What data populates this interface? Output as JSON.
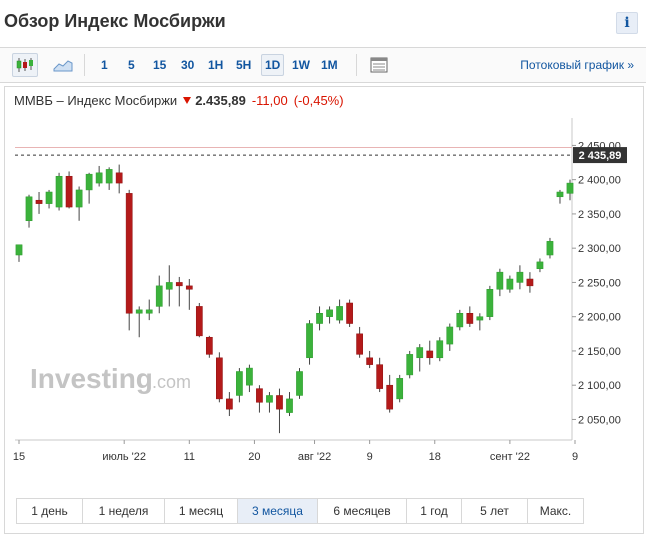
{
  "page": {
    "title": "Обзор Индекс Мосбиржи",
    "info_label": "i"
  },
  "toolbar": {
    "chart_type_icons": [
      "candlestick-icon",
      "area-chart-icon"
    ],
    "timeframes": [
      {
        "label": "1",
        "active": false
      },
      {
        "label": "5",
        "active": false
      },
      {
        "label": "15",
        "active": false
      },
      {
        "label": "30",
        "active": false
      },
      {
        "label": "1H",
        "active": false
      },
      {
        "label": "5H",
        "active": false
      },
      {
        "label": "1D",
        "active": true
      },
      {
        "label": "1W",
        "active": false
      },
      {
        "label": "1M",
        "active": false
      }
    ],
    "table_icon": "table-view-icon",
    "stream_link": "Потоковый график »"
  },
  "quote": {
    "name": "ММВБ – Индекс Мосбиржи",
    "direction": "down",
    "price": "2.435,89",
    "change": "-11,00",
    "change_pct": "(-0,45%)",
    "current_price_label": "2.435,89",
    "current_price_tag": "2 435,89"
  },
  "watermark": {
    "text": "Investing",
    "suffix": ".com"
  },
  "colors": {
    "up": "#3bb23b",
    "down": "#b41a1a",
    "link": "#1256a0",
    "negative": "#d91400"
  },
  "chart_data": {
    "type": "candlestick",
    "y_range": [
      2020,
      2490
    ],
    "y_ticks": [
      "2 050,00",
      "2 100,00",
      "2 150,00",
      "2 200,00",
      "2 250,00",
      "2 300,00",
      "2 350,00",
      "2 400,00",
      "2 450,00"
    ],
    "y_tick_values": [
      2050,
      2100,
      2150,
      2200,
      2250,
      2300,
      2350,
      2400,
      2450
    ],
    "x_ticks": [
      {
        "label": "15",
        "index": 0
      },
      {
        "label": "июль '22",
        "index": 10.5
      },
      {
        "label": "11",
        "index": 17
      },
      {
        "label": "20",
        "index": 23.5
      },
      {
        "label": "авг '22",
        "index": 29.5
      },
      {
        "label": "9",
        "index": 35
      },
      {
        "label": "18",
        "index": 41.5
      },
      {
        "label": "сент '22",
        "index": 49
      },
      {
        "label": "9",
        "index": 55.5
      }
    ],
    "reference_level": 2447,
    "current_price": 2435.89,
    "candles": [
      {
        "o": 2290,
        "h": 2295,
        "l": 2280,
        "c": 2305
      },
      {
        "o": 2340,
        "h": 2378,
        "l": 2330,
        "c": 2375
      },
      {
        "o": 2370,
        "h": 2382,
        "l": 2350,
        "c": 2365
      },
      {
        "o": 2365,
        "h": 2385,
        "l": 2358,
        "c": 2382
      },
      {
        "o": 2360,
        "h": 2410,
        "l": 2355,
        "c": 2405
      },
      {
        "o": 2405,
        "h": 2412,
        "l": 2358,
        "c": 2360
      },
      {
        "o": 2360,
        "h": 2390,
        "l": 2340,
        "c": 2385
      },
      {
        "o": 2385,
        "h": 2410,
        "l": 2365,
        "c": 2408
      },
      {
        "o": 2395,
        "h": 2420,
        "l": 2390,
        "c": 2410
      },
      {
        "o": 2395,
        "h": 2418,
        "l": 2385,
        "c": 2415
      },
      {
        "o": 2410,
        "h": 2422,
        "l": 2380,
        "c": 2395
      },
      {
        "o": 2380,
        "h": 2385,
        "l": 2180,
        "c": 2205
      },
      {
        "o": 2205,
        "h": 2215,
        "l": 2170,
        "c": 2210
      },
      {
        "o": 2205,
        "h": 2225,
        "l": 2195,
        "c": 2210
      },
      {
        "o": 2215,
        "h": 2260,
        "l": 2205,
        "c": 2245
      },
      {
        "o": 2240,
        "h": 2275,
        "l": 2215,
        "c": 2250
      },
      {
        "o": 2250,
        "h": 2258,
        "l": 2215,
        "c": 2245
      },
      {
        "o": 2245,
        "h": 2255,
        "l": 2210,
        "c": 2240
      },
      {
        "o": 2215,
        "h": 2220,
        "l": 2170,
        "c": 2172
      },
      {
        "o": 2170,
        "h": 2172,
        "l": 2140,
        "c": 2145
      },
      {
        "o": 2140,
        "h": 2148,
        "l": 2075,
        "c": 2080
      },
      {
        "o": 2080,
        "h": 2090,
        "l": 2055,
        "c": 2065
      },
      {
        "o": 2085,
        "h": 2125,
        "l": 2075,
        "c": 2120
      },
      {
        "o": 2100,
        "h": 2130,
        "l": 2090,
        "c": 2125
      },
      {
        "o": 2095,
        "h": 2100,
        "l": 2060,
        "c": 2075
      },
      {
        "o": 2075,
        "h": 2090,
        "l": 2060,
        "c": 2085
      },
      {
        "o": 2085,
        "h": 2095,
        "l": 2030,
        "c": 2065
      },
      {
        "o": 2060,
        "h": 2090,
        "l": 2055,
        "c": 2080
      },
      {
        "o": 2085,
        "h": 2125,
        "l": 2080,
        "c": 2120
      },
      {
        "o": 2140,
        "h": 2195,
        "l": 2130,
        "c": 2190
      },
      {
        "o": 2190,
        "h": 2215,
        "l": 2180,
        "c": 2205
      },
      {
        "o": 2200,
        "h": 2215,
        "l": 2190,
        "c": 2210
      },
      {
        "o": 2195,
        "h": 2225,
        "l": 2190,
        "c": 2215
      },
      {
        "o": 2220,
        "h": 2225,
        "l": 2185,
        "c": 2190
      },
      {
        "o": 2175,
        "h": 2185,
        "l": 2140,
        "c": 2145
      },
      {
        "o": 2140,
        "h": 2150,
        "l": 2125,
        "c": 2130
      },
      {
        "o": 2130,
        "h": 2140,
        "l": 2090,
        "c": 2095
      },
      {
        "o": 2100,
        "h": 2115,
        "l": 2060,
        "c": 2065
      },
      {
        "o": 2080,
        "h": 2115,
        "l": 2075,
        "c": 2110
      },
      {
        "o": 2115,
        "h": 2150,
        "l": 2110,
        "c": 2145
      },
      {
        "o": 2140,
        "h": 2160,
        "l": 2120,
        "c": 2155
      },
      {
        "o": 2150,
        "h": 2165,
        "l": 2130,
        "c": 2140
      },
      {
        "o": 2140,
        "h": 2170,
        "l": 2135,
        "c": 2165
      },
      {
        "o": 2160,
        "h": 2190,
        "l": 2150,
        "c": 2185
      },
      {
        "o": 2185,
        "h": 2210,
        "l": 2180,
        "c": 2205
      },
      {
        "o": 2205,
        "h": 2215,
        "l": 2185,
        "c": 2190
      },
      {
        "o": 2195,
        "h": 2205,
        "l": 2180,
        "c": 2200
      },
      {
        "o": 2200,
        "h": 2245,
        "l": 2195,
        "c": 2240
      },
      {
        "o": 2240,
        "h": 2270,
        "l": 2230,
        "c": 2265
      },
      {
        "o": 2240,
        "h": 2260,
        "l": 2235,
        "c": 2255
      },
      {
        "o": 2250,
        "h": 2275,
        "l": 2240,
        "c": 2265
      },
      {
        "o": 2255,
        "h": 2265,
        "l": 2235,
        "c": 2245
      },
      {
        "o": 2270,
        "h": 2285,
        "l": 2265,
        "c": 2280
      },
      {
        "o": 2290,
        "h": 2315,
        "l": 2285,
        "c": 2310
      },
      {
        "o": 2375,
        "h": 2385,
        "l": 2365,
        "c": 2382
      },
      {
        "o": 2380,
        "h": 2400,
        "l": 2370,
        "c": 2395
      }
    ]
  },
  "range_buttons": [
    {
      "label": "1 день",
      "active": false
    },
    {
      "label": "1 неделя",
      "active": false
    },
    {
      "label": "1 месяц",
      "active": false
    },
    {
      "label": "3 месяца",
      "active": true
    },
    {
      "label": "6 месяцев",
      "active": false
    },
    {
      "label": "1 год",
      "active": false
    },
    {
      "label": "5 лет",
      "active": false
    },
    {
      "label": "Макс.",
      "active": false
    }
  ]
}
